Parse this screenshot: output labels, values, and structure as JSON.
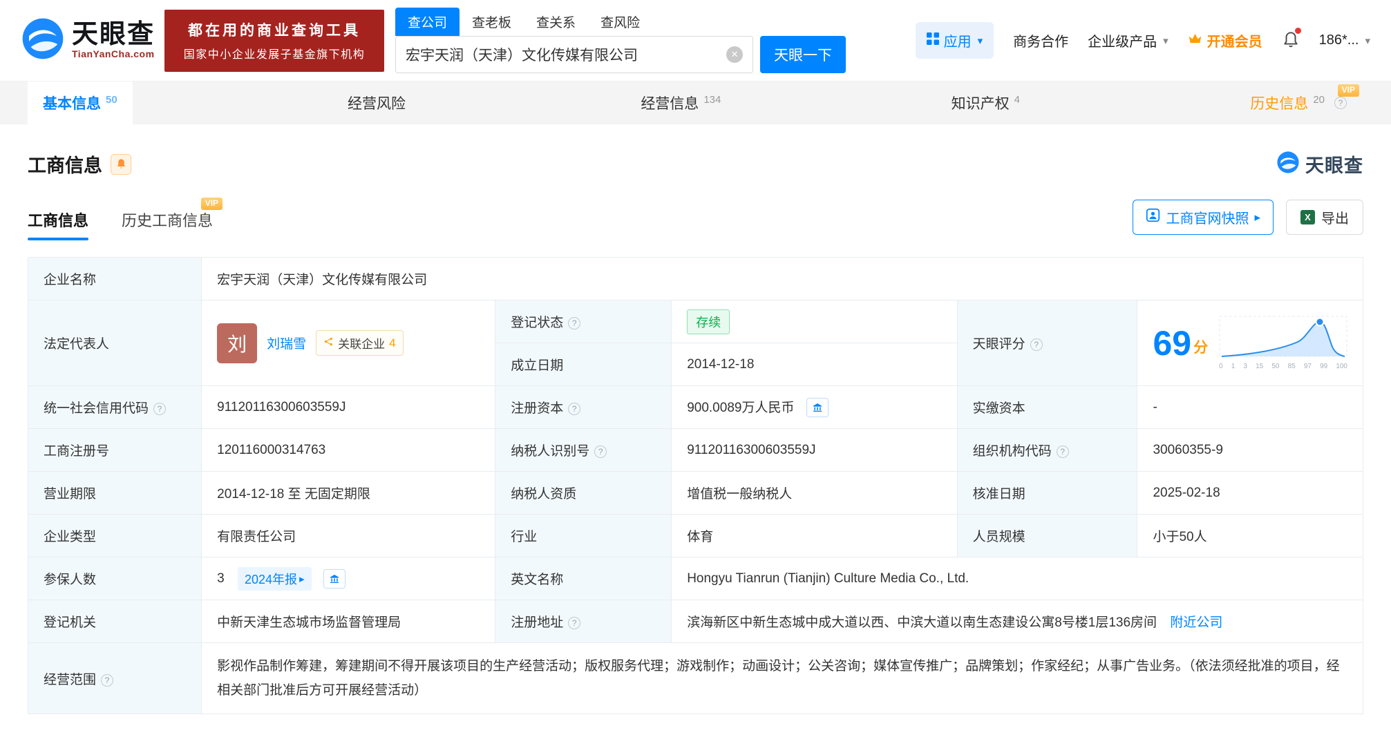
{
  "colors": {
    "brand_blue": "#0084ff",
    "banner_red": "#a5231f",
    "member_orange": "#ff8a00",
    "vip_orange": "#ff9d00",
    "status_green": "#00b34a"
  },
  "header": {
    "logo": {
      "title": "天眼查",
      "subtitle": "TianYanCha.com"
    },
    "banner": {
      "line1": "都在用的商业查询工具",
      "line2": "国家中小企业发展子基金旗下机构"
    },
    "search": {
      "tabs": [
        "查公司",
        "查老板",
        "查关系",
        "查风险"
      ],
      "value": "宏宇天润（天津）文化传媒有限公司",
      "button": "天眼一下"
    },
    "nav": {
      "app": "应用",
      "biz": "商务合作",
      "enterprise": "企业级产品",
      "member": "开通会员",
      "phone": "186*..."
    }
  },
  "tabbar": {
    "items": [
      {
        "label": "基本信息",
        "count": "50"
      },
      {
        "label": "经营风险",
        "count": ""
      },
      {
        "label": "经营信息",
        "count": "134"
      },
      {
        "label": "知识产权",
        "count": "4"
      },
      {
        "label": "历史信息",
        "count": "20",
        "vip": "VIP"
      }
    ]
  },
  "section": {
    "title": "工商信息",
    "brand": "天眼查",
    "subtabs": [
      {
        "label": "工商信息"
      },
      {
        "label": "历史工商信息",
        "vip": "VIP"
      }
    ],
    "actions": {
      "snapshot": "工商官网快照",
      "export": "导出"
    }
  },
  "info": {
    "companyName": {
      "label": "企业名称",
      "value": "宏宇天润（天津）文化传媒有限公司"
    },
    "legalRep": {
      "label": "法定代表人",
      "avatar": "刘",
      "name": "刘瑞雪",
      "related": "关联企业",
      "relatedCount": "4"
    },
    "regStatus": {
      "label": "登记状态",
      "value": "存续"
    },
    "estDate": {
      "label": "成立日期",
      "value": "2014-12-18"
    },
    "score": {
      "label": "天眼评分",
      "value": "69",
      "unit": "分",
      "axis": [
        "0",
        "1",
        "3",
        "15",
        "50",
        "85",
        "97",
        "99",
        "100"
      ]
    },
    "creditCode": {
      "label": "统一社会信用代码",
      "value": "91120116300603559J"
    },
    "regCapital": {
      "label": "注册资本",
      "value": "900.0089万人民币"
    },
    "paidCapital": {
      "label": "实缴资本",
      "value": "-"
    },
    "regNumber": {
      "label": "工商注册号",
      "value": "120116000314763"
    },
    "taxId": {
      "label": "纳税人识别号",
      "value": "91120116300603559J"
    },
    "orgCode": {
      "label": "组织机构代码",
      "value": "30060355-9"
    },
    "businessTerm": {
      "label": "营业期限",
      "value": "2014-12-18 至 无固定期限"
    },
    "taxpayerQual": {
      "label": "纳税人资质",
      "value": "增值税一般纳税人"
    },
    "approvalDate": {
      "label": "核准日期",
      "value": "2025-02-18"
    },
    "companyType": {
      "label": "企业类型",
      "value": "有限责任公司"
    },
    "industry": {
      "label": "行业",
      "value": "体育"
    },
    "staffSize": {
      "label": "人员规模",
      "value": "小于50人"
    },
    "insured": {
      "label": "参保人数",
      "value": "3",
      "report": "2024年报"
    },
    "englishName": {
      "label": "英文名称",
      "value": "Hongyu Tianrun (Tianjin) Culture Media Co., Ltd."
    },
    "regAuthority": {
      "label": "登记机关",
      "value": "中新天津生态城市场监督管理局"
    },
    "address": {
      "label": "注册地址",
      "value": "滨海新区中新生态城中成大道以西、中滨大道以南生态建设公寓8号楼1层136房间",
      "nearby": "附近公司"
    },
    "businessScope": {
      "label": "经营范围",
      "value": "影视作品制作筹建，筹建期间不得开展该项目的生产经营活动；版权服务代理；游戏制作；动画设计；公关咨询；媒体宣传推广；品牌策划；作家经纪；从事广告业务。（依法须经批准的项目，经相关部门批准后方可开展经营活动）"
    }
  }
}
